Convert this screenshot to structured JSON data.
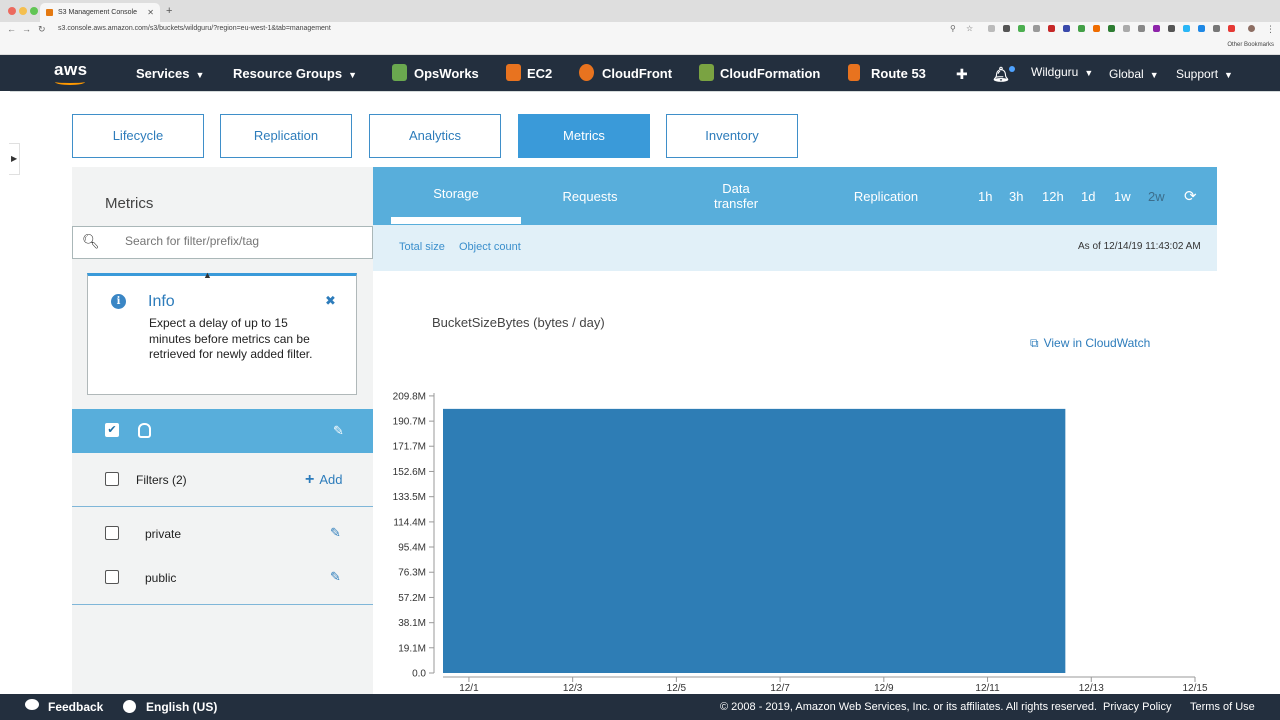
{
  "browser": {
    "tab_title": "S3 Management Console",
    "url": "s3.console.aws.amazon.com/s3/buckets/wildguru/?region=eu-west-1&tab=management",
    "bookmarks_label": "Other Bookmarks"
  },
  "nav": {
    "logo": "aws",
    "services": "Services",
    "resource_groups": "Resource Groups",
    "pinned": [
      "OpsWorks",
      "EC2",
      "CloudFront",
      "CloudFormation",
      "Route 53"
    ],
    "pinned_colors": [
      "#6aa84f",
      "#e8731f",
      "#e8731f",
      "#7aa342",
      "#e8731f"
    ],
    "account": "Wildguru",
    "region": "Global",
    "support": "Support"
  },
  "mgmt_tabs": [
    "Lifecycle",
    "Replication",
    "Analytics",
    "Metrics",
    "Inventory"
  ],
  "mgmt_active": "Metrics",
  "left": {
    "title": "Metrics",
    "search_placeholder": "Search for filter/prefix/tag",
    "info": {
      "title": "Info",
      "text": "Expect a delay of up to 15 minutes before metrics can be retrieved for newly added filter."
    },
    "filters_label": "Filters (2)",
    "add_label": "Add",
    "filters": [
      "private",
      "public"
    ]
  },
  "metric_tabs": [
    "Storage",
    "Requests",
    "Data\ntransfer",
    "Replication"
  ],
  "metric_active": "Storage",
  "time_ranges": [
    "1h",
    "3h",
    "12h",
    "1d",
    "1w",
    "2w"
  ],
  "time_active": "2w",
  "sub_links": [
    "Total size",
    "Object count"
  ],
  "as_of": "As of 12/14/19 11:43:02 AM",
  "cloudwatch_link": "View in CloudWatch",
  "colors": {
    "nav": "#232f3e",
    "accent": "#3a9ad9",
    "bar": "#2e7db5"
  },
  "chart_data": {
    "type": "area",
    "title": "BucketSizeBytes (bytes / day)",
    "xlabel": "",
    "ylabel": "",
    "y_ticks": [
      "0.0",
      "19.1M",
      "38.1M",
      "57.2M",
      "76.3M",
      "95.4M",
      "114.4M",
      "133.5M",
      "152.6M",
      "171.7M",
      "190.7M",
      "209.8M"
    ],
    "y_tick_values": [
      0,
      19.1,
      38.1,
      57.2,
      76.3,
      95.4,
      114.4,
      133.5,
      152.6,
      171.7,
      190.7,
      209.8
    ],
    "x_ticks": [
      "12/1",
      "12/3",
      "12/5",
      "12/7",
      "12/9",
      "12/11",
      "12/13",
      "12/15"
    ],
    "x_tick_values": [
      1,
      3,
      5,
      7,
      9,
      11,
      13,
      15
    ],
    "ylim": [
      0,
      212
    ],
    "xlim": [
      0.5,
      15
    ],
    "series": [
      {
        "x": [
          0.5,
          12.5
        ],
        "y": [
          200,
          200
        ]
      }
    ]
  },
  "footer": {
    "feedback": "Feedback",
    "language": "English (US)",
    "copyright": "© 2008 - 2019, Amazon Web Services, Inc. or its affiliates. All rights reserved.",
    "privacy": "Privacy Policy",
    "terms": "Terms of Use"
  }
}
